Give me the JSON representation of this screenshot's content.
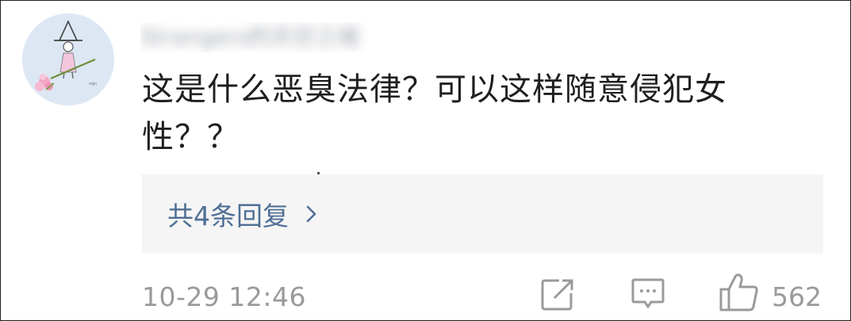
{
  "comment": {
    "username": "Strangers的天空之城",
    "text": "这是什么恶臭法律？可以这样随意侵犯女性？？",
    "replies_label": "共4条回复",
    "timestamp": "10-29 12:46",
    "like_count": "562"
  },
  "icons": {
    "avatar": "avatar-illustration",
    "reply_chevron": "chevron-right-icon",
    "share": "share-icon",
    "comment": "comment-icon",
    "like": "thumbs-up-icon"
  },
  "colors": {
    "link": "#4f6f95",
    "meta_text": "#9a9a9a",
    "reply_bg": "#f5f5f5"
  }
}
